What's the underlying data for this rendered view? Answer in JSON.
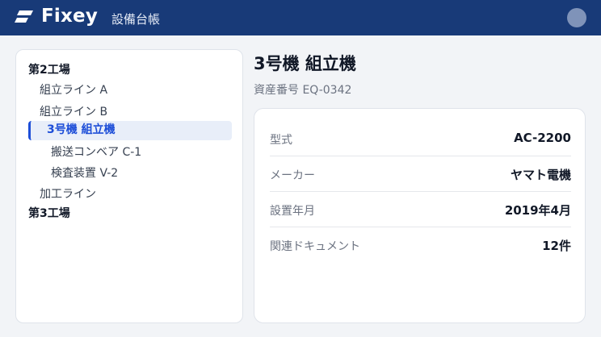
{
  "header": {
    "brand": "Fixey",
    "section": "設備台帳",
    "colors": {
      "background": "#183a78",
      "accent": "#1d4ed8"
    }
  },
  "tree": {
    "items": [
      {
        "label": "第2工場",
        "level": 0
      },
      {
        "label": "組立ライン A",
        "level": 1
      },
      {
        "label": "組立ライン B",
        "level": 1
      },
      {
        "label": "3号機 組立機",
        "level": 2,
        "selected": true
      },
      {
        "label": "搬送コンベア C-1",
        "level": 2
      },
      {
        "label": "検査装置 V-2",
        "level": 2
      },
      {
        "label": "加工ライン",
        "level": 1
      },
      {
        "label": "第3工場",
        "level": 0
      }
    ]
  },
  "detail": {
    "title": "3号機 組立機",
    "asset_number": "資産番号 EQ-0342",
    "rows": [
      {
        "label": "型式",
        "value": "AC-2200"
      },
      {
        "label": "メーカー",
        "value": "ヤマト電機"
      },
      {
        "label": "設置年月",
        "value": "2019年4月"
      },
      {
        "label": "関連ドキュメント",
        "value": "12件"
      }
    ]
  }
}
